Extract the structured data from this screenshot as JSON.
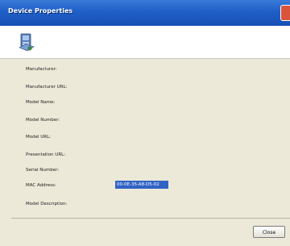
{
  "window": {
    "title": "Device Properties"
  },
  "properties": [
    {
      "label": "Manufacturer:",
      "value": ""
    },
    {
      "label": "Manufacturer URL:",
      "value": ""
    },
    {
      "label": "Model Name:",
      "value": ""
    },
    {
      "label": "Model Number:",
      "value": ""
    },
    {
      "label": "Model URL:",
      "value": ""
    },
    {
      "label": "Presentation URL:",
      "value": ""
    },
    {
      "label": "Serial Number:",
      "value": ""
    },
    {
      "label": "MAC Address:",
      "value": "00-0E-35-A8-D5-02"
    },
    {
      "label": "Model Description:",
      "value": ""
    }
  ],
  "buttons": {
    "close_label": "Close"
  },
  "icons": {
    "window_icon": "device-properties-icon",
    "title_close": "close-icon"
  },
  "colors": {
    "titlebar": "#1f5fc8",
    "selection": "#3163c5",
    "dialog_bg": "#ece9d8"
  }
}
